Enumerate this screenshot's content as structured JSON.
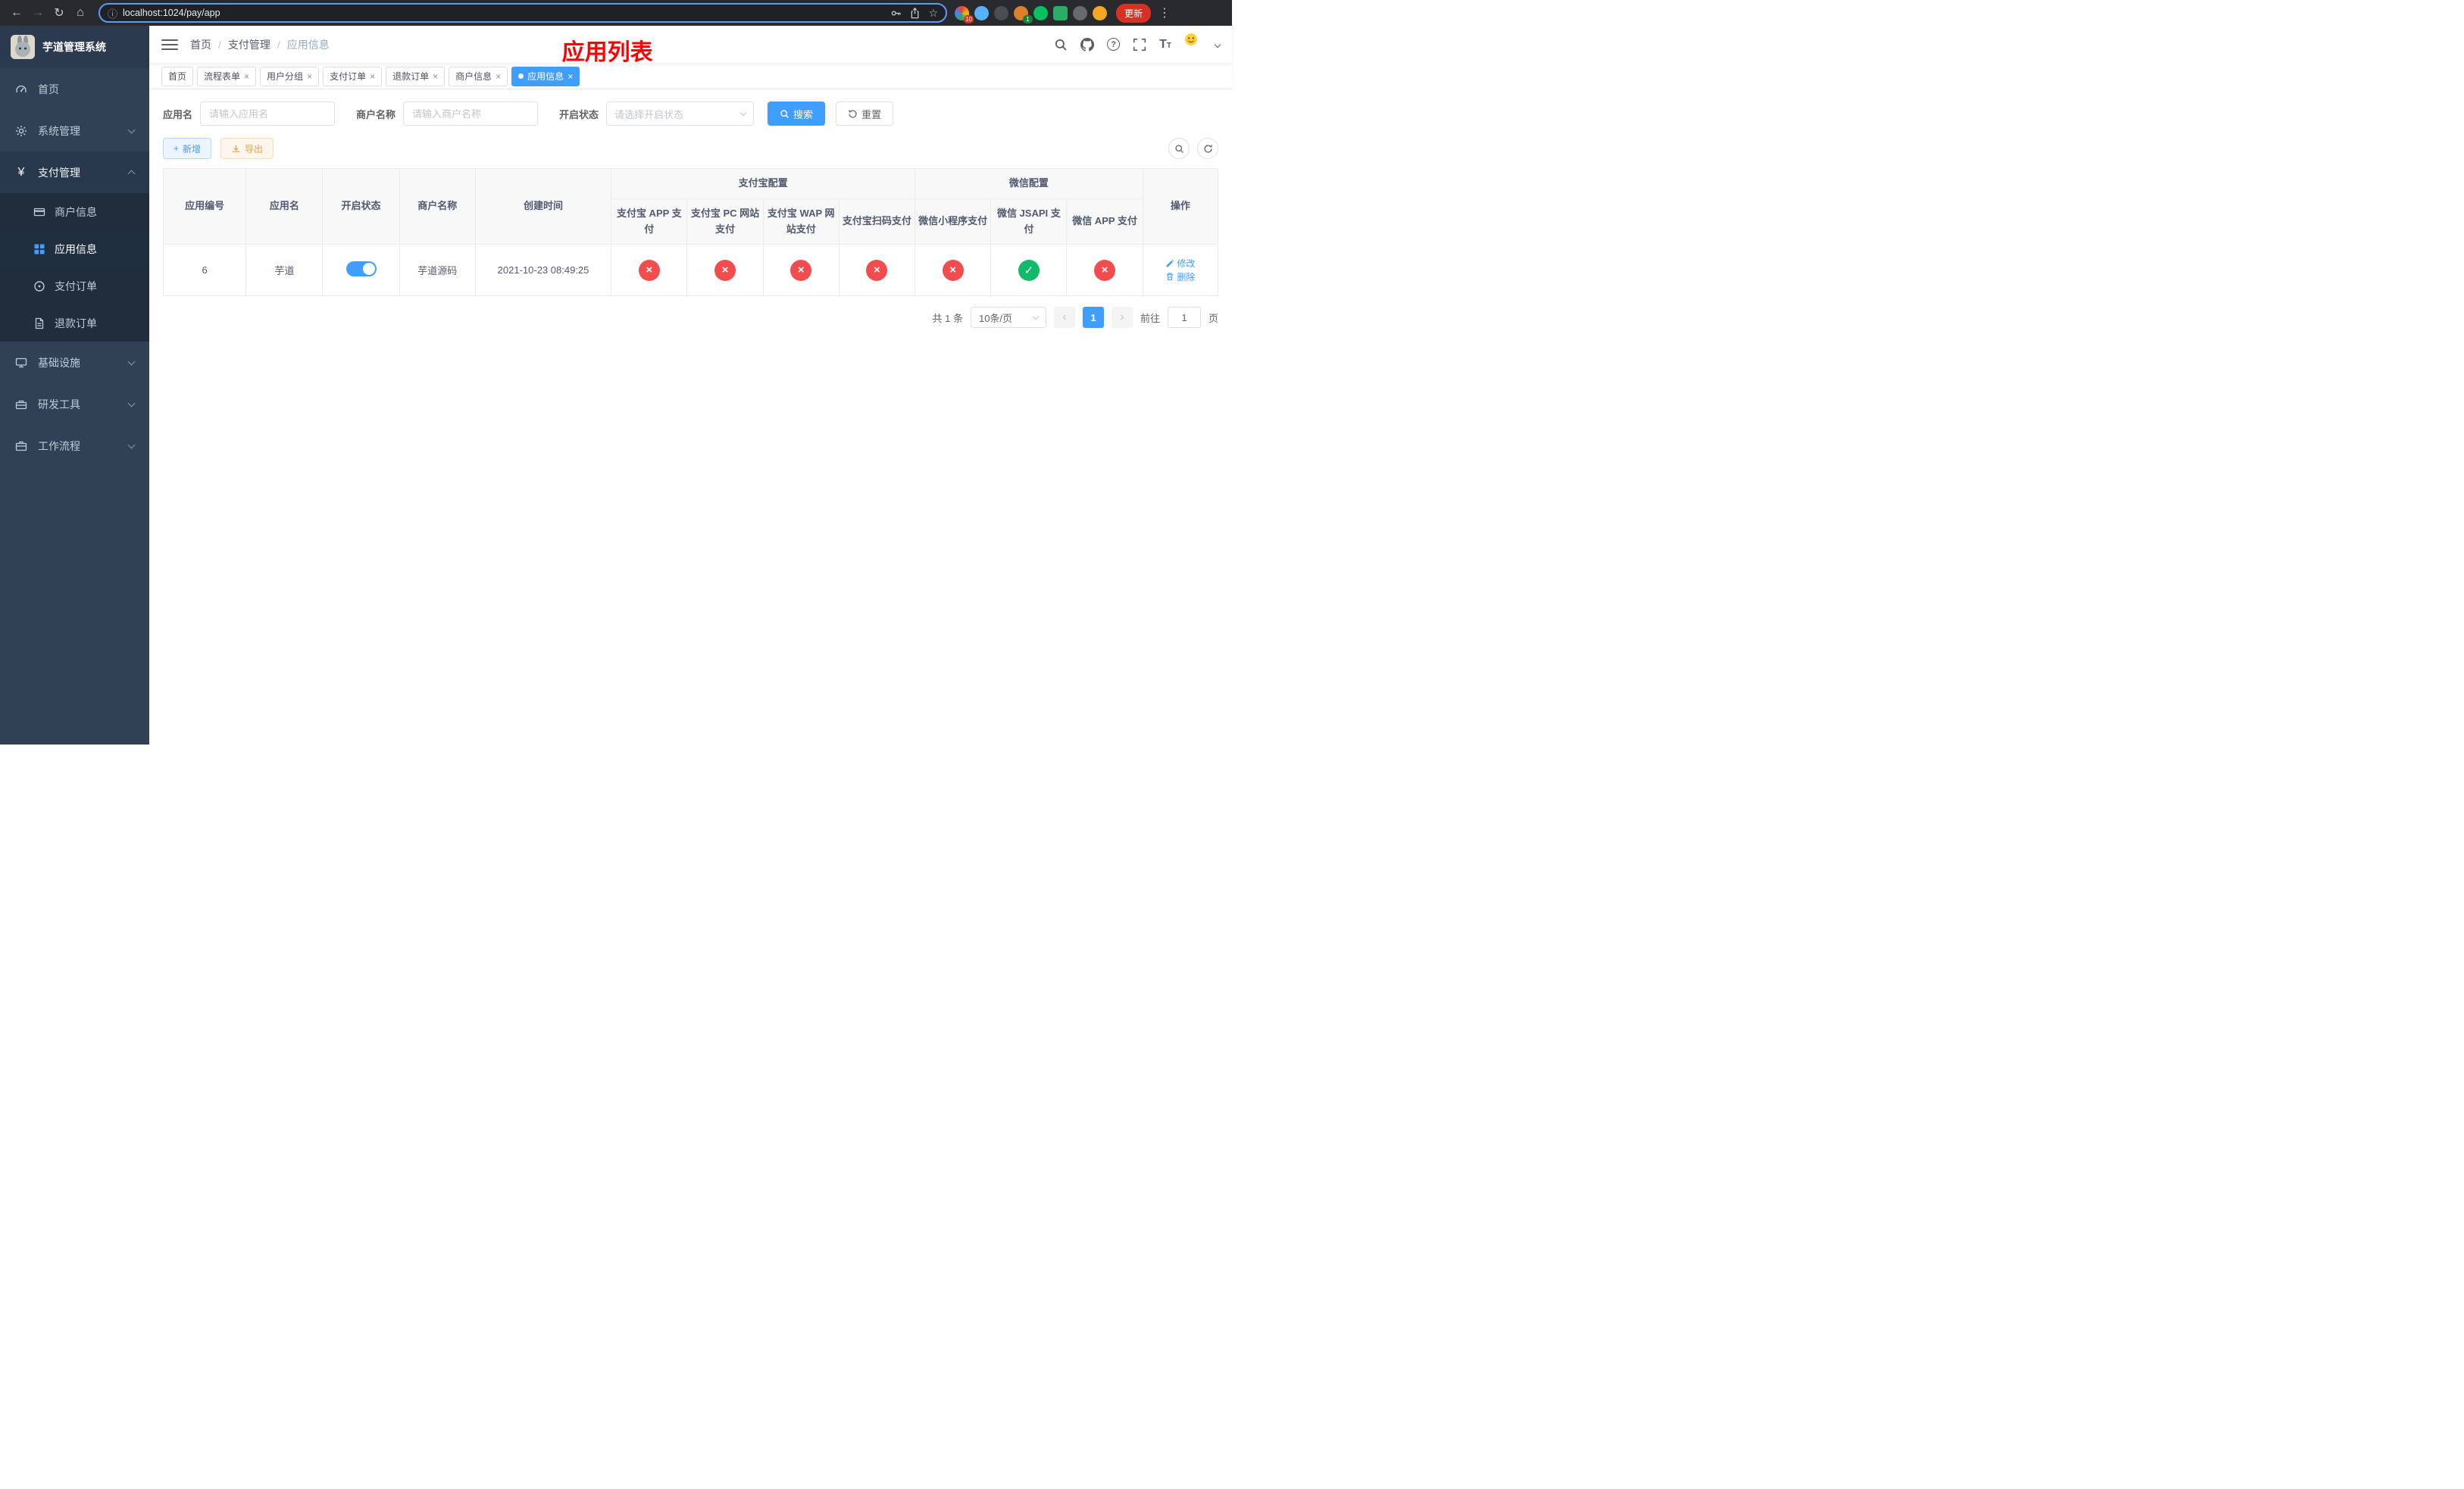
{
  "colors": {
    "primary": "#409eff",
    "success": "#10ba69",
    "danger": "#f24c4f",
    "warning": "#e6a23c",
    "title_red": "#ff0000"
  },
  "icons": {
    "back": "←",
    "forward": "→",
    "reload": "↻",
    "home": "⌂",
    "info": "ⓘ",
    "star": "☆",
    "dots": "⋮",
    "close": "×",
    "plus": "+",
    "prev": "‹",
    "next": "›",
    "question": "?",
    "font_big": "T",
    "font_small": "T",
    "status_on_glyph": "✓",
    "status_off_glyph": "×"
  },
  "browser": {
    "url": "localhost:1024/pay/app",
    "update_label": "更新",
    "ext_badge_10": "10",
    "ext_badge_1": "1"
  },
  "sidebar": {
    "app_title": "芋道管理系统",
    "items": [
      {
        "label": "首页"
      },
      {
        "label": "系统管理"
      },
      {
        "label": "支付管理"
      },
      {
        "label": "商户信息"
      },
      {
        "label": "应用信息"
      },
      {
        "label": "支付订单"
      },
      {
        "label": "退款订单"
      },
      {
        "label": "基础设施"
      },
      {
        "label": "研发工具"
      },
      {
        "label": "工作流程"
      }
    ]
  },
  "navbar": {
    "breadcrumb": [
      "首页",
      "支付管理",
      "应用信息"
    ],
    "breadcrumb_sep": "/",
    "page_title": "应用列表"
  },
  "tabs": [
    {
      "label": "首页"
    },
    {
      "label": "流程表单"
    },
    {
      "label": "用户分组"
    },
    {
      "label": "支付订单"
    },
    {
      "label": "退款订单"
    },
    {
      "label": "商户信息"
    },
    {
      "label": "应用信息"
    }
  ],
  "search_form": {
    "app_name_label": "应用名",
    "app_name_placeholder": "请输入应用名",
    "merchant_label": "商户名称",
    "merchant_placeholder": "请输入商户名称",
    "status_label": "开启状态",
    "status_placeholder": "请选择开启状态",
    "search_button": "搜索",
    "reset_button": "重置"
  },
  "toolbar": {
    "add_label": "新增",
    "export_label": "导出"
  },
  "table": {
    "headers": {
      "app_id": "应用编号",
      "app_name": "应用名",
      "status": "开启状态",
      "merchant_name": "商户名称",
      "create_time": "创建时间",
      "alipay_group": "支付宝配置",
      "wechat_group": "微信配置",
      "alipay_app": "支付宝 APP 支付",
      "alipay_pc": "支付宝 PC 网站支付",
      "alipay_wap": "支付宝 WAP 网站支付",
      "alipay_qr": "支付宝扫码支付",
      "wx_lite": "微信小程序支付",
      "wx_jsapi": "微信 JSAPI 支付",
      "wx_app": "微信 APP 支付",
      "actions": "操作"
    },
    "rows": [
      {
        "app_id": "6",
        "app_name": "芋道",
        "status_on": true,
        "merchant_name": "芋道源码",
        "create_time": "2021-10-23 08:49:25",
        "alipay_app": "disabled",
        "alipay_pc": "disabled",
        "alipay_wap": "disabled",
        "alipay_qr": "disabled",
        "wx_lite": "disabled",
        "wx_jsapi": "enabled",
        "wx_app": "disabled",
        "edit_label": "修改",
        "delete_label": "删除"
      }
    ]
  },
  "pagination": {
    "total_text": "共 1 条",
    "page_size": "10条/页",
    "current_page": "1",
    "goto_label": "前往",
    "goto_value": "1",
    "page_suffix": "页"
  }
}
